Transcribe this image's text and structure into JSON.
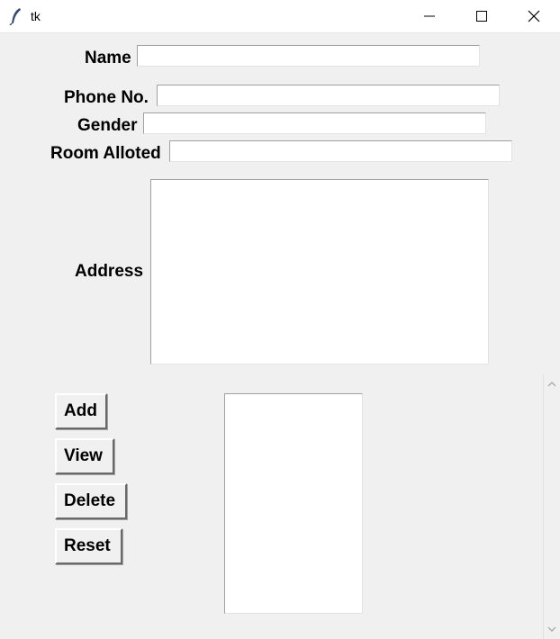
{
  "window": {
    "title": "tk",
    "icons": [
      "feather-icon",
      "minimize-icon",
      "maximize-icon",
      "close-icon"
    ]
  },
  "form": {
    "name_label": "Name",
    "name_value": "",
    "phone_label": "Phone No.",
    "phone_value": "",
    "gender_label": "Gender",
    "gender_value": "",
    "room_label": "Room Alloted",
    "room_value": "",
    "address_label": "Address",
    "address_value": ""
  },
  "buttons": {
    "add": "Add",
    "view": "View",
    "delete": "Delete",
    "reset": "Reset"
  },
  "records": {
    "items": []
  },
  "scrollbar": {
    "icons": [
      "chevron-up-icon",
      "chevron-down-icon"
    ]
  }
}
